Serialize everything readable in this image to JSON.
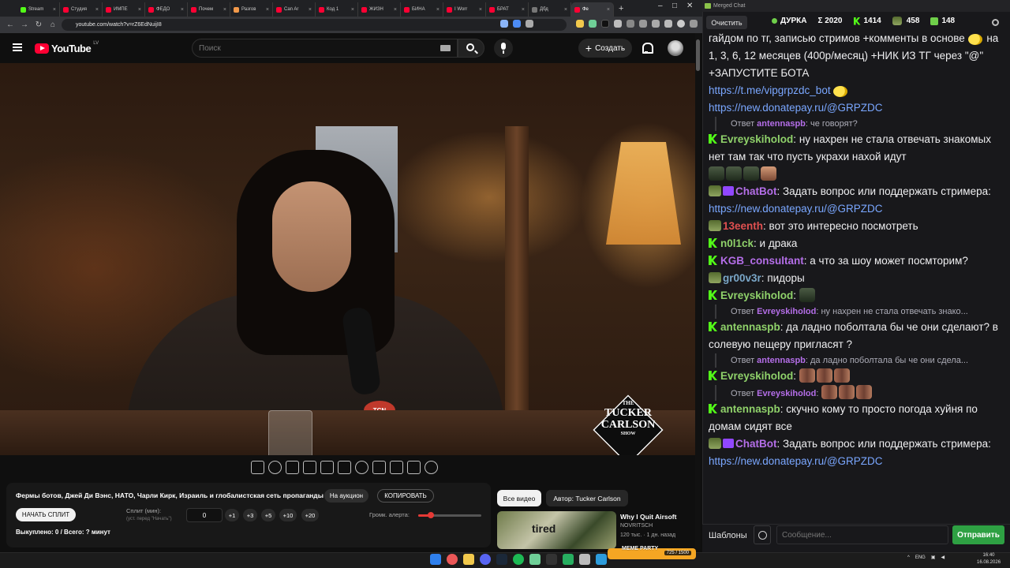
{
  "browser": {
    "tabs": [
      {
        "label": "Stream",
        "color": "#53fc18"
      },
      {
        "label": "Студия",
        "color": "#ff0033"
      },
      {
        "label": "ИМПЕ",
        "color": "#ff0033"
      },
      {
        "label": "ФЕДО",
        "color": "#ff0033"
      },
      {
        "label": "Почем",
        "color": "#ff0033"
      },
      {
        "label": "Разгов",
        "color": "#f2994a"
      },
      {
        "label": "Can Ar",
        "color": "#ff0033"
      },
      {
        "label": "Код 1",
        "color": "#ff0033"
      },
      {
        "label": "ЖИЗН",
        "color": "#ff0033"
      },
      {
        "label": "БИНА",
        "color": "#ff0033"
      },
      {
        "label": "I Worr",
        "color": "#ff0033"
      },
      {
        "label": "БРАТ",
        "color": "#ff0033"
      },
      {
        "label": "Дбд",
        "color": "#777777"
      },
      {
        "label": "Фе",
        "color": "#ff0033"
      }
    ],
    "url": "youtube.com/watch?v=rZ6EdNuijI8"
  },
  "youtube": {
    "logo_text": "YouTube",
    "region": "LV",
    "search_placeholder": "Поиск",
    "create_label": "Создать",
    "video_overlay": {
      "badge": "TCN",
      "logo_line1": "THE",
      "logo_line2": "TUCKER",
      "logo_line3": "CARLSON",
      "logo_line4": "SHOW"
    }
  },
  "split_panel": {
    "title": "Фермы ботов, Джей Ди Вэнс, НАТО, Чарли Кирк, Израиль и глобалистская сеть пропаганды",
    "auction_label": "На аукцион",
    "copy_label": "КОПИРОВАТЬ",
    "start_label": "НАЧАТЬ СПЛИТ",
    "split_label": "Сплит (мин):",
    "split_hint": "(уст. перед \"Начать\")",
    "split_value": "0",
    "steps": [
      "+1",
      "+3",
      "+5",
      "+10",
      "+20"
    ],
    "alert_volume_label": "Громк. алерта:",
    "alert_volume": 0.2,
    "bought_text": "Выкуплено: 0 / Всего: ? минут"
  },
  "related": {
    "chip_all": "Все видео",
    "chip_author": "Автор: Tucker Carlson",
    "thumb_text": "tired",
    "title": "Why I Quit Airsoft",
    "channel": "NOVRITSCH",
    "meta": "120 тыс. · 1 дн. назад"
  },
  "chat": {
    "window_title": "Merged Chat",
    "clear_label": "Очистить",
    "stats": [
      {
        "icon": "online-dot-icon",
        "value": "ДУРКА"
      },
      {
        "icon": "sigma-icon",
        "value": "Σ 2020"
      },
      {
        "icon": "kick-icon",
        "value": "1414"
      },
      {
        "icon": "soldier-icon",
        "value": "458"
      },
      {
        "icon": "vk-icon",
        "value": "148"
      }
    ],
    "messages": [
      {
        "type": "text",
        "text": "гайдом по тг, записью стримов +комменты в основе",
        "tail": "на 1, 3, 6, 12 месяцев (400р/месяц) +НИК ИЗ ТГ через \"@\" +ЗАПУСТИТЕ БОТА"
      },
      {
        "type": "link",
        "text": "https://t.me/vipgrpzdc_bot"
      },
      {
        "type": "link",
        "text": "https://new.donatepay.ru/@GRPZDC"
      },
      {
        "type": "reply",
        "prefix": "Ответ",
        "user": "antennaspb",
        "text": ": че говорят?"
      },
      {
        "type": "msg",
        "badge": "kick",
        "user": "Evreyskiholod",
        "color": "#8fd16a",
        "text": "ну нахрен не стала отвечать знакомых нет там так что пусть украхи нахой идут"
      },
      {
        "type": "msg",
        "badge": "bot",
        "user": "ChatBot",
        "color": "#b46ee8",
        "text": "Задать вопрос или поддержать стримера:",
        "link": "https://new.donatepay.ru/@GRPZDC"
      },
      {
        "type": "msg",
        "badge": "soldier",
        "user": "13eenth",
        "color": "#e05050",
        "text": "вот это интересно посмотреть"
      },
      {
        "type": "msg",
        "badge": "kick",
        "user": "n0l1ck",
        "color": "#8fd16a",
        "text": "и драка"
      },
      {
        "type": "msg",
        "badge": "kick",
        "user": "KGB_consultant",
        "color": "#b46ee8",
        "text": "а что за шоу может посмторим?"
      },
      {
        "type": "msg",
        "badge": "soldier",
        "user": "gr00v3r",
        "color": "#7aa7c8",
        "text": "пидоры"
      },
      {
        "type": "msg",
        "badge": "kick",
        "user": "Evreyskiholod",
        "color": "#8fd16a",
        "text": ""
      },
      {
        "type": "reply",
        "prefix": "Ответ",
        "user": "Evreyskiholod",
        "text": ": ну нахрен не стала отвечать знако..."
      },
      {
        "type": "msg",
        "badge": "kick",
        "user": "antennaspb",
        "color": "#8fd16a",
        "text": "да ладно поболтала бы че они сделают? в солевую пещеру пригласят ?"
      },
      {
        "type": "reply",
        "prefix": "Ответ",
        "user": "antennaspb",
        "text": ": да ладно поболтала бы че они сдела..."
      },
      {
        "type": "msg",
        "badge": "kick",
        "user": "Evreyskiholod",
        "color": "#8fd16a",
        "text": ""
      },
      {
        "type": "reply",
        "prefix": "Ответ",
        "user": "Evreyskiholod",
        "text": ":"
      },
      {
        "type": "msg",
        "badge": "kick",
        "user": "antennaspb",
        "color": "#8fd16a",
        "text": "скучно кому то просто погода хуйня по домам сидят все"
      },
      {
        "type": "msg",
        "badge": "bot",
        "user": "ChatBot",
        "color": "#b46ee8",
        "text": "Задать вопрос или поддержать стримера:",
        "link": "https://new.donatepay.ru/@GRPZDC"
      }
    ],
    "templates_label": "Шаблоны",
    "input_placeholder": "Сообщение...",
    "send_label": "Отправить"
  },
  "taskbar": {
    "widget_title": "MEME PARTY",
    "widget_value": "725 / 1500",
    "lang": "ENG",
    "time": "16:40",
    "date": "16.08.2026"
  }
}
